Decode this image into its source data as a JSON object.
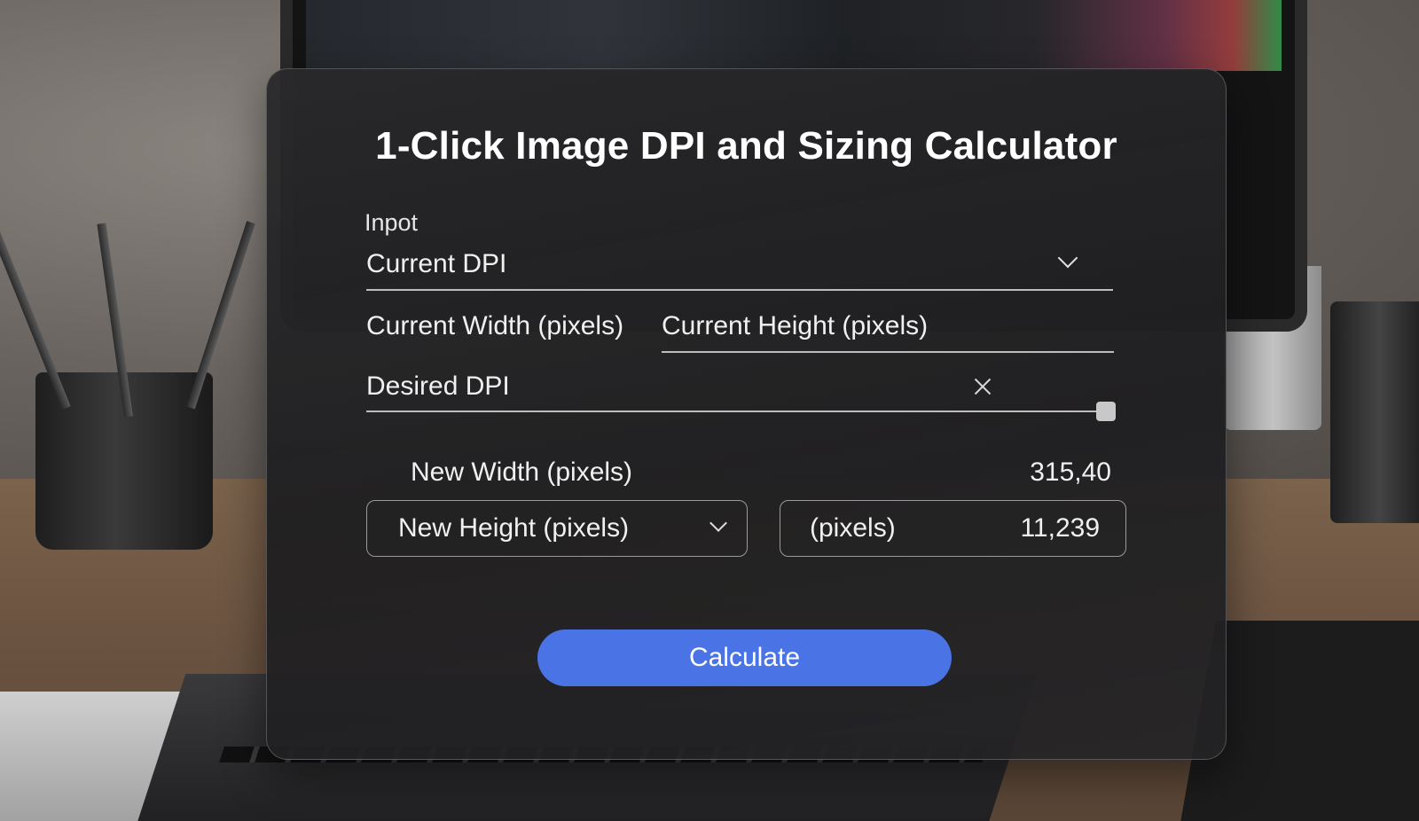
{
  "app": {
    "title": "1-Click Image DPI and Sizing Calculator"
  },
  "input_section": {
    "label": "Inpot",
    "current_dpi": {
      "label": "Current DPI"
    },
    "current_width": {
      "label": "Current Width (pixels)"
    },
    "current_height": {
      "label": "Current Height (pixels)"
    },
    "desired_dpi": {
      "label": "Desired DPI"
    }
  },
  "results": {
    "new_width": {
      "label": "New Width (pixels)",
      "value": "315,40"
    },
    "new_height": {
      "label": "New Height (pixels)"
    },
    "pixels_field": {
      "label": "(pixels)",
      "value": "11,239"
    }
  },
  "actions": {
    "calculate_label": "Calculate"
  },
  "colors": {
    "accent": "#4a74e6",
    "card_bg": "#1e1e20",
    "text": "#f2f2f2"
  },
  "icons": {
    "dropdown": "chevron-down-icon",
    "clear": "close-icon"
  }
}
